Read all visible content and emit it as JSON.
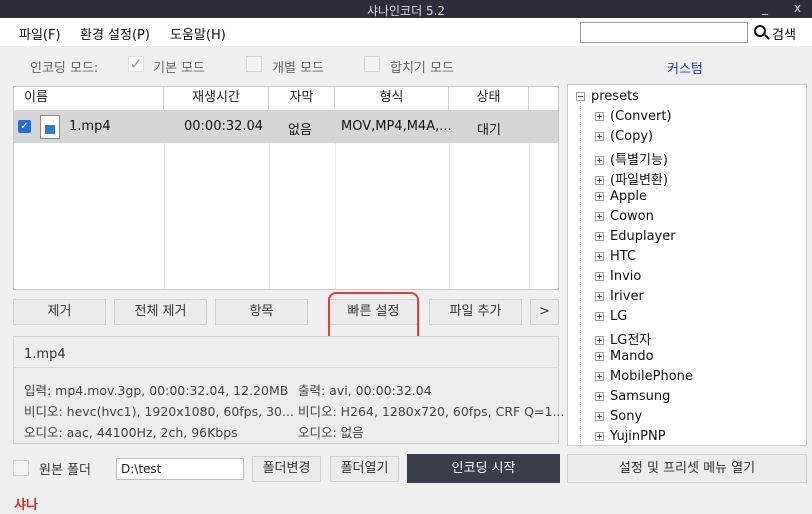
{
  "window": {
    "title": "샤나인코더 5.2",
    "minimize": "_",
    "close": "x"
  },
  "menu": {
    "file": "파일(F)",
    "settings": "환경 설정(P)",
    "help": "도움말(H)"
  },
  "search": {
    "value": "",
    "label": "검색"
  },
  "modes": {
    "label": "인코딩 모드:",
    "basic": "기본 모드",
    "individual": "개별 모드",
    "merge": "합치기 모드",
    "selected": "basic",
    "custom": "커스텀"
  },
  "table": {
    "headers": [
      "이름",
      "재생시간",
      "자막",
      "형식",
      "상태"
    ],
    "rows": [
      {
        "name": "1.mp4",
        "duration": "00:00:32.04",
        "subtitle": "없음",
        "format": "MOV,MP4,M4A,...",
        "status": "대기"
      }
    ]
  },
  "actions": {
    "remove": "제거",
    "remove_all": "전체 제거",
    "items": "항목",
    "quick_settings": "빠른 설정",
    "add_file": "파일 추가",
    "more": ">"
  },
  "info": {
    "filename": "1.mp4",
    "input": "입력: mp4.mov.3gp, 00:00:32.04, 12.20MB",
    "video_in": "비디오: hevc(hvc1), 1920x1080, 60fps, 30...",
    "audio_in": "오디오: aac, 44100Hz, 2ch, 96Kbps",
    "output": "출력: avi, 00:00:32.04",
    "video_out": "비디오: H264, 1280x720, 60fps, CRF Q=1...",
    "audio_out": "오디오: 없음"
  },
  "tree": {
    "root": "presets",
    "items": [
      "(Convert)",
      "(Copy)",
      "(특별기능)",
      "(파일변환)",
      "Apple",
      "Cowon",
      "Eduplayer",
      "HTC",
      "Invio",
      "Iriver",
      "LG",
      "LG전자",
      "Mando",
      "MobilePhone",
      "Samsung",
      "Sony",
      "YujinPNP"
    ]
  },
  "bottom": {
    "original_folder": "원본 폴더",
    "path": "D:\\test",
    "change_folder": "폴더변경",
    "open_folder": "폴더열기",
    "start": "인코딩 시작",
    "preset_menu": "설정 및 프리셋 메뉴 열기"
  },
  "footer": {
    "brand": "샤나"
  },
  "colors": {
    "titlebar": "#2b2e3a",
    "accent_check": "#e36f9a",
    "link": "#1f3fbf",
    "highlight": "#e53b3b",
    "brand": "#dd2222",
    "start_button": "#3a3d4b"
  }
}
